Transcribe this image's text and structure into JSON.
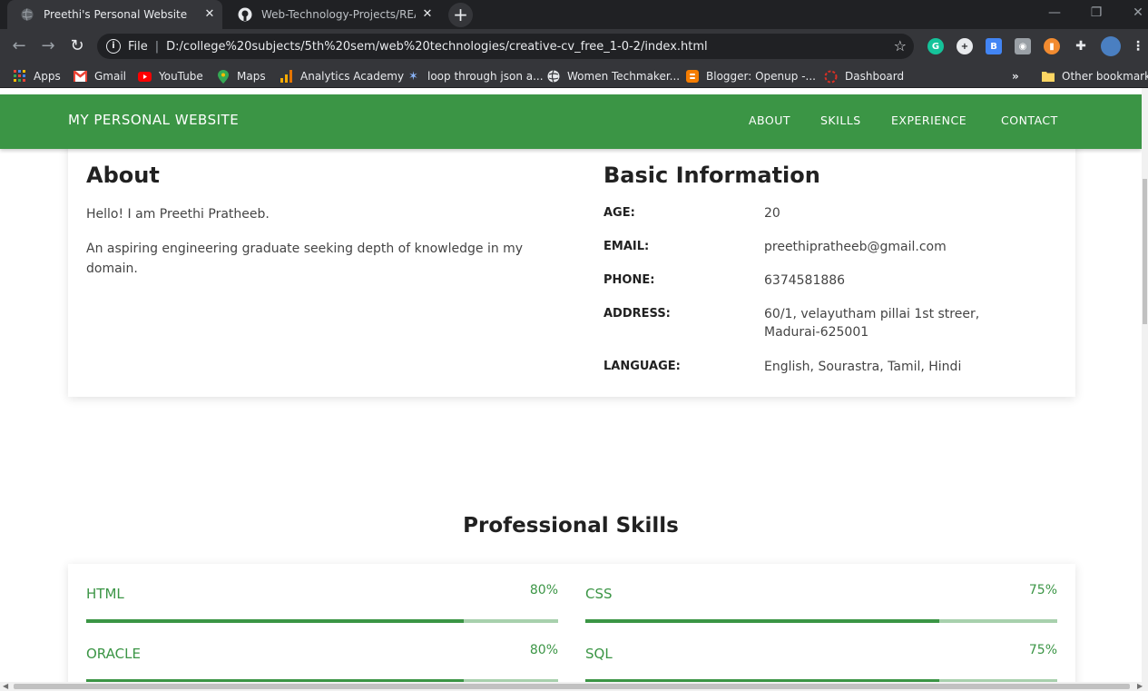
{
  "browser": {
    "tabs": [
      {
        "title": "Preethi's Personal Website",
        "active": true
      },
      {
        "title": "Web-Technology-Projects/READI",
        "active": false
      }
    ],
    "address": {
      "scheme": "File",
      "url": "D:/college%20subjects/5th%20sem/web%20technologies/creative-cv_free_1-0-2/index.html"
    },
    "bookmarks": [
      {
        "label": "Apps",
        "icon": "apps-grid-icon"
      },
      {
        "label": "Gmail",
        "icon": "gmail-icon"
      },
      {
        "label": "YouTube",
        "icon": "youtube-icon"
      },
      {
        "label": "Maps",
        "icon": "maps-pin-icon"
      },
      {
        "label": "Analytics Academy",
        "icon": "analytics-icon"
      },
      {
        "label": "loop through json a...",
        "icon": "sparkle-icon"
      },
      {
        "label": "Women Techmaker...",
        "icon": "globe-icon"
      },
      {
        "label": "Blogger: Openup -...",
        "icon": "blogger-icon"
      },
      {
        "label": "Dashboard",
        "icon": "dashboard-icon"
      }
    ],
    "overflow": "»",
    "other_bookmarks": "Other bookmarks"
  },
  "site": {
    "brand": "MY PERSONAL WEBSITE",
    "nav": [
      "ABOUT",
      "SKILLS",
      "EXPERIENCE",
      "CONTACT"
    ],
    "accent_color": "#3b9545"
  },
  "about": {
    "title": "About",
    "paragraphs": [
      "Hello! I am Preethi Pratheeb.",
      "An aspiring engineering graduate seeking depth of knowledge in my domain."
    ]
  },
  "basic_info": {
    "title": "Basic Information",
    "rows": [
      {
        "label": "AGE:",
        "value": "20"
      },
      {
        "label": "EMAIL:",
        "value": "preethipratheeb@gmail.com"
      },
      {
        "label": "PHONE:",
        "value": "6374581886"
      },
      {
        "label": "ADDRESS:",
        "value": "60/1, velayutham pillai 1st streer, Madurai-625001"
      },
      {
        "label": "LANGUAGE:",
        "value": "English, Sourastra, Tamil, Hindi"
      }
    ]
  },
  "skills": {
    "title": "Professional Skills",
    "items": [
      {
        "name": "HTML",
        "percent_label": "80%",
        "percent": 80
      },
      {
        "name": "CSS",
        "percent_label": "75%",
        "percent": 75
      },
      {
        "name": "ORACLE",
        "percent_label": "80%",
        "percent": 80
      },
      {
        "name": "SQL",
        "percent_label": "75%",
        "percent": 75
      }
    ]
  }
}
